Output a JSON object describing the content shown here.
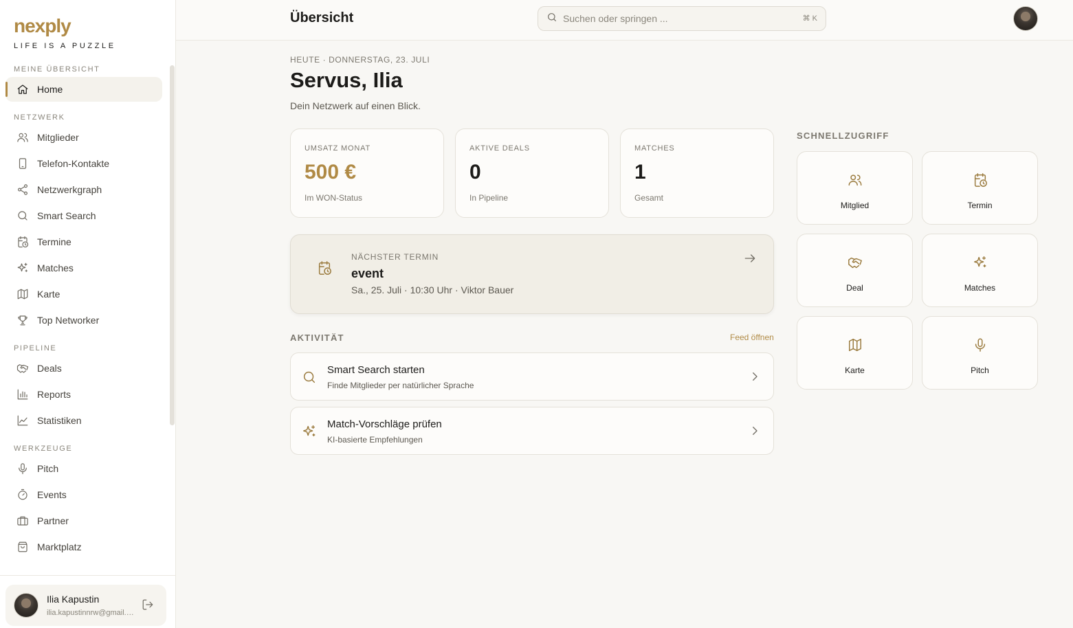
{
  "brand": {
    "name": "nexply",
    "tagline": "LIFE IS A PUZZLE"
  },
  "sidebar": {
    "sections": [
      {
        "title": "MEINE ÜBERSICHT",
        "items": [
          {
            "label": "Home",
            "icon": "home-icon",
            "active": true
          }
        ]
      },
      {
        "title": "NETZWERK",
        "items": [
          {
            "label": "Mitglieder",
            "icon": "users-icon"
          },
          {
            "label": "Telefon-Kontakte",
            "icon": "phone-icon"
          },
          {
            "label": "Netzwerkgraph",
            "icon": "share-graph-icon"
          },
          {
            "label": "Smart Search",
            "icon": "search-icon"
          },
          {
            "label": "Termine",
            "icon": "calendar-clock-icon"
          },
          {
            "label": "Matches",
            "icon": "sparkles-icon"
          },
          {
            "label": "Karte",
            "icon": "map-icon"
          },
          {
            "label": "Top Networker",
            "icon": "trophy-icon"
          }
        ]
      },
      {
        "title": "PIPELINE",
        "items": [
          {
            "label": "Deals",
            "icon": "handshake-icon"
          },
          {
            "label": "Reports",
            "icon": "bar-chart-icon"
          },
          {
            "label": "Statistiken",
            "icon": "line-chart-icon"
          }
        ]
      },
      {
        "title": "WERKZEUGE",
        "items": [
          {
            "label": "Pitch",
            "icon": "microphone-icon"
          },
          {
            "label": "Events",
            "icon": "timer-icon"
          },
          {
            "label": "Partner",
            "icon": "briefcase-icon"
          },
          {
            "label": "Marktplatz",
            "icon": "shopping-bag-icon"
          }
        ]
      }
    ],
    "user": {
      "name": "Ilia Kapustin",
      "email": "ilia.kapustinnrw@gmail.com"
    }
  },
  "header": {
    "title": "Übersicht",
    "search_placeholder": "Suchen oder springen ...",
    "shortcut": "⌘ K"
  },
  "main": {
    "date_line": "HEUTE · DONNERSTAG, 23. JULI",
    "greeting": "Servus, Ilia",
    "subline": "Dein Netzwerk auf einen Blick.",
    "stats": [
      {
        "label": "UMSATZ MONAT",
        "value": "500 €",
        "sub": "Im WON-Status",
        "accent": true
      },
      {
        "label": "AKTIVE DEALS",
        "value": "0",
        "sub": "In Pipeline",
        "accent": false
      },
      {
        "label": "MATCHES",
        "value": "1",
        "sub": "Gesamt",
        "accent": false
      }
    ],
    "next_event": {
      "label": "NÄCHSTER TERMIN",
      "title": "event",
      "meta": "Sa., 25. Juli · 10:30 Uhr · Viktor Bauer"
    },
    "activity": {
      "title": "AKTIVITÄT",
      "feed_link": "Feed öffnen",
      "items": [
        {
          "title": "Smart Search starten",
          "subtitle": "Finde Mitglieder per natürlicher Sprache",
          "icon": "search-icon"
        },
        {
          "title": "Match-Vorschläge prüfen",
          "subtitle": "KI-basierte Empfehlungen",
          "icon": "sparkles-icon"
        }
      ]
    },
    "quick_access": {
      "title": "SCHNELLZUGRIFF",
      "items": [
        {
          "label": "Mitglied",
          "icon": "users-icon"
        },
        {
          "label": "Termin",
          "icon": "calendar-clock-icon"
        },
        {
          "label": "Deal",
          "icon": "handshake-icon"
        },
        {
          "label": "Matches",
          "icon": "sparkles-icon"
        },
        {
          "label": "Karte",
          "icon": "map-icon"
        },
        {
          "label": "Pitch",
          "icon": "microphone-icon"
        }
      ]
    }
  },
  "colors": {
    "accent": "#b08a45",
    "background": "#f8f7f4",
    "sidebar": "#ffffff"
  }
}
